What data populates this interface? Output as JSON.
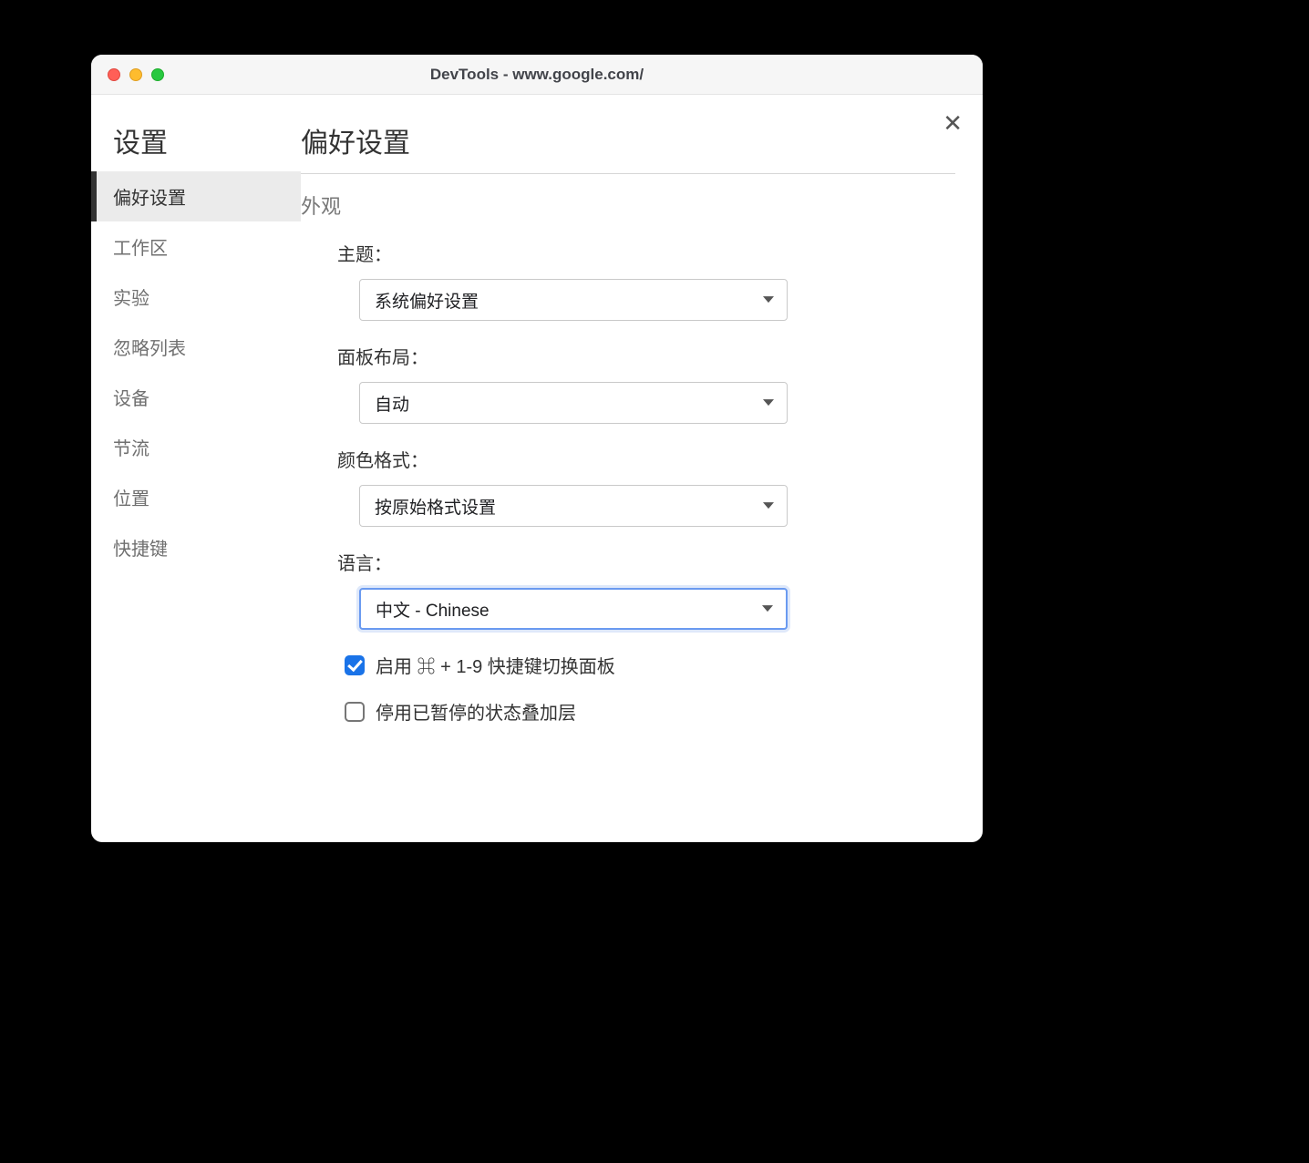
{
  "window": {
    "title": "DevTools - www.google.com/"
  },
  "sidebar": {
    "title": "设置",
    "items": [
      {
        "label": "偏好设置",
        "active": true
      },
      {
        "label": "工作区",
        "active": false
      },
      {
        "label": "实验",
        "active": false
      },
      {
        "label": "忽略列表",
        "active": false
      },
      {
        "label": "设备",
        "active": false
      },
      {
        "label": "节流",
        "active": false
      },
      {
        "label": "位置",
        "active": false
      },
      {
        "label": "快捷键",
        "active": false
      }
    ]
  },
  "main": {
    "page_title": "偏好设置",
    "section_title": "外观",
    "fields": {
      "theme": {
        "label": "主题：",
        "value": "系统偏好设置"
      },
      "panel_layout": {
        "label": "面板布局：",
        "value": "自动"
      },
      "color_format": {
        "label": "颜色格式：",
        "value": "按原始格式设置"
      },
      "language": {
        "label": "语言：",
        "value": "中文 - Chinese"
      }
    },
    "checkboxes": {
      "enable_shortcut": {
        "label": "启用 ⌘ + 1-9 快捷键切换面板",
        "checked": true
      },
      "disable_overlay": {
        "label": "停用已暂停的状态叠加层",
        "checked": false
      }
    }
  }
}
